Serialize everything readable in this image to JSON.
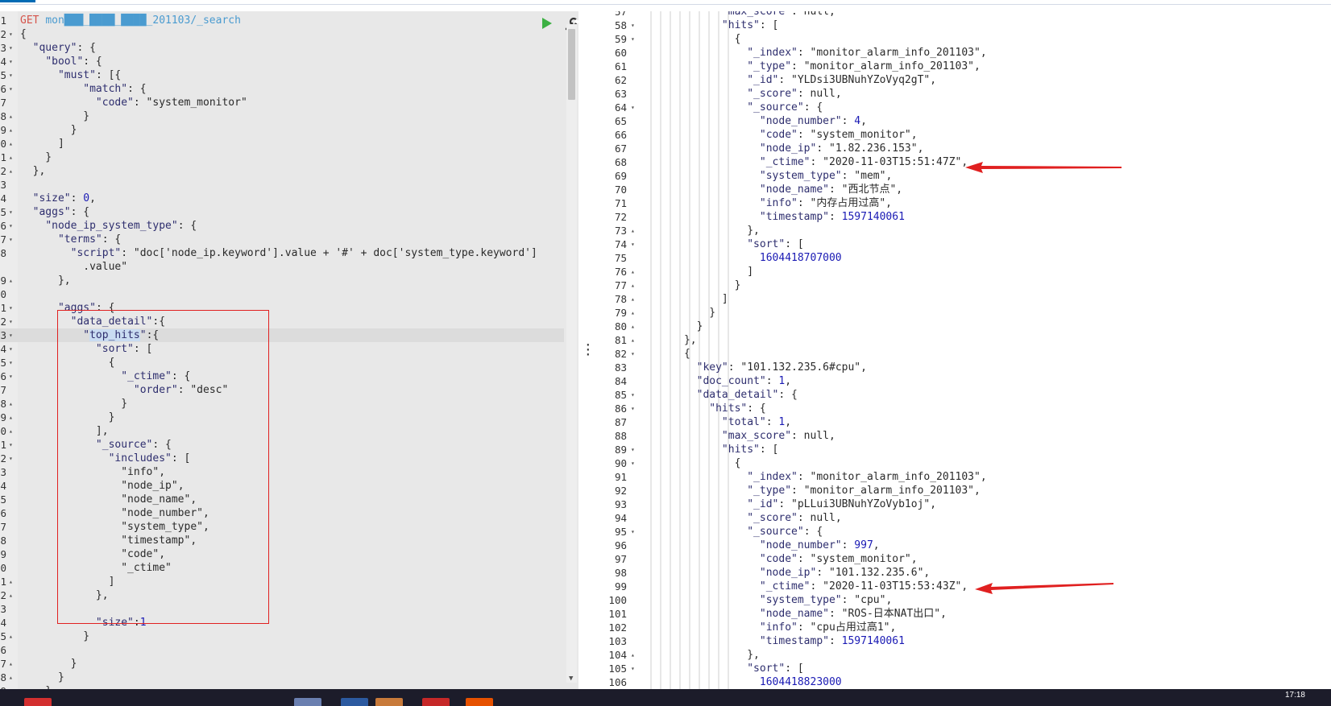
{
  "left_editor": {
    "lines": [
      {
        "num": "1",
        "fold": "",
        "html": "<span class=\"kw\">GET</span> <span class=\"url\">mon&#9608;&#9608;&#9608;_&#9608;&#9608;&#9608;&#9608;_&#9608;&#9608;&#9608;&#9608;_201103/_search</span>"
      },
      {
        "num": "2",
        "fold": "▾",
        "html": "{"
      },
      {
        "num": "3",
        "fold": "▾",
        "html": "  <span class=\"k\">\"query\"</span>: {"
      },
      {
        "num": "4",
        "fold": "▾",
        "html": "    <span class=\"k\">\"bool\"</span>: {"
      },
      {
        "num": "5",
        "fold": "▾",
        "html": "      <span class=\"k\">\"must\"</span>: [{"
      },
      {
        "num": "6",
        "fold": "▾",
        "html": "          <span class=\"k\">\"match\"</span>: {"
      },
      {
        "num": "7",
        "fold": "",
        "html": "            <span class=\"k\">\"code\"</span>: <span class=\"s\">\"system_monitor\"</span>"
      },
      {
        "num": "8",
        "fold": "▴",
        "html": "          }"
      },
      {
        "num": "9",
        "fold": "▴",
        "html": "        }"
      },
      {
        "num": "0",
        "fold": "▴",
        "html": "      ]"
      },
      {
        "num": "1",
        "fold": "▴",
        "html": "    }"
      },
      {
        "num": "2",
        "fold": "▴",
        "html": "  },"
      },
      {
        "num": "3",
        "fold": "",
        "html": ""
      },
      {
        "num": "4",
        "fold": "",
        "html": "  <span class=\"k\">\"size\"</span>: <span class=\"n\">0</span>,"
      },
      {
        "num": "5",
        "fold": "▾",
        "html": "  <span class=\"k\">\"aggs\"</span>: {"
      },
      {
        "num": "6",
        "fold": "▾",
        "html": "    <span class=\"k\">\"node_ip_system_type\"</span>: {"
      },
      {
        "num": "7",
        "fold": "▾",
        "html": "      <span class=\"k\">\"terms\"</span>: {"
      },
      {
        "num": "8",
        "fold": "",
        "html": "        <span class=\"k\">\"script\"</span>: <span class=\"s\">\"doc['node_ip.keyword'].value + '#' + doc['system_type.keyword']</span>"
      },
      {
        "num": "",
        "fold": "",
        "html": "          <span class=\"s\">.value\"</span>"
      },
      {
        "num": "9",
        "fold": "▴",
        "html": "      },"
      },
      {
        "num": "0",
        "fold": "",
        "html": ""
      },
      {
        "num": "1",
        "fold": "▾",
        "html": "      <span class=\"k\">\"aggs\"</span>: {"
      },
      {
        "num": "2",
        "fold": "▾",
        "html": "        <span class=\"k\">\"data_detail\"</span>:{"
      },
      {
        "num": "3",
        "fold": "▾",
        "html": "          <span class=\"k\">\"<span class=\"hl\">top_hits</span>\"</span>:{",
        "active": true
      },
      {
        "num": "4",
        "fold": "▾",
        "html": "            <span class=\"k\">\"sort\"</span>: ["
      },
      {
        "num": "5",
        "fold": "▾",
        "html": "              {"
      },
      {
        "num": "6",
        "fold": "▾",
        "html": "                <span class=\"k\">\"_ctime\"</span>: {"
      },
      {
        "num": "7",
        "fold": "",
        "html": "                  <span class=\"k\">\"order\"</span>: <span class=\"s\">\"desc\"</span>"
      },
      {
        "num": "8",
        "fold": "▴",
        "html": "                }"
      },
      {
        "num": "9",
        "fold": "▴",
        "html": "              }"
      },
      {
        "num": "0",
        "fold": "▴",
        "html": "            ],"
      },
      {
        "num": "1",
        "fold": "▾",
        "html": "            <span class=\"k\">\"_source\"</span>: {"
      },
      {
        "num": "2",
        "fold": "▾",
        "html": "              <span class=\"k\">\"includes\"</span>: ["
      },
      {
        "num": "3",
        "fold": "",
        "html": "                <span class=\"s\">\"info\"</span>,"
      },
      {
        "num": "4",
        "fold": "",
        "html": "                <span class=\"s\">\"node_ip\"</span>,"
      },
      {
        "num": "5",
        "fold": "",
        "html": "                <span class=\"s\">\"node_name\"</span>,"
      },
      {
        "num": "6",
        "fold": "",
        "html": "                <span class=\"s\">\"node_number\"</span>,"
      },
      {
        "num": "7",
        "fold": "",
        "html": "                <span class=\"s\">\"system_type\"</span>,"
      },
      {
        "num": "8",
        "fold": "",
        "html": "                <span class=\"s\">\"timestamp\"</span>,"
      },
      {
        "num": "9",
        "fold": "",
        "html": "                <span class=\"s\">\"code\"</span>,"
      },
      {
        "num": "0",
        "fold": "",
        "html": "                <span class=\"s\">\"_ctime\"</span>"
      },
      {
        "num": "1",
        "fold": "▴",
        "html": "              ]"
      },
      {
        "num": "2",
        "fold": "▴",
        "html": "            },"
      },
      {
        "num": "3",
        "fold": "",
        "html": ""
      },
      {
        "num": "4",
        "fold": "",
        "html": "            <span class=\"k\">\"size\"</span>:<span class=\"n\">1</span>"
      },
      {
        "num": "5",
        "fold": "▴",
        "html": "          }"
      },
      {
        "num": "6",
        "fold": "",
        "html": ""
      },
      {
        "num": "7",
        "fold": "▴",
        "html": "        }"
      },
      {
        "num": "8",
        "fold": "▴",
        "html": "      }"
      },
      {
        "num": "9",
        "fold": "▴",
        "html": "    }"
      }
    ]
  },
  "right_output": {
    "lines": [
      {
        "num": "57",
        "fold": "",
        "html": "            <span class=\"k\">\"max_score\"</span>: null,"
      },
      {
        "num": "58",
        "fold": "▾",
        "html": "            <span class=\"k\">\"hits\"</span>: ["
      },
      {
        "num": "59",
        "fold": "▾",
        "html": "              {"
      },
      {
        "num": "60",
        "fold": "",
        "html": "                <span class=\"k\">\"_index\"</span>: <span class=\"s\">\"monitor_alarm_info_201103\"</span>,"
      },
      {
        "num": "61",
        "fold": "",
        "html": "                <span class=\"k\">\"_type\"</span>: <span class=\"s\">\"monitor_alarm_info_201103\"</span>,"
      },
      {
        "num": "62",
        "fold": "",
        "html": "                <span class=\"k\">\"_id\"</span>: <span class=\"s\">\"YLDsi3UBNuhYZoVyq2gT\"</span>,"
      },
      {
        "num": "63",
        "fold": "",
        "html": "                <span class=\"k\">\"_score\"</span>: null,"
      },
      {
        "num": "64",
        "fold": "▾",
        "html": "                <span class=\"k\">\"_source\"</span>: {"
      },
      {
        "num": "65",
        "fold": "",
        "html": "                  <span class=\"k\">\"node_number\"</span>: <span class=\"n\">4</span>,"
      },
      {
        "num": "66",
        "fold": "",
        "html": "                  <span class=\"k\">\"code\"</span>: <span class=\"s\">\"system_monitor\"</span>,"
      },
      {
        "num": "67",
        "fold": "",
        "html": "                  <span class=\"k\">\"node_ip\"</span>: <span class=\"s\">\"1.82.236.153\"</span>,"
      },
      {
        "num": "68",
        "fold": "",
        "html": "                  <span class=\"k\">\"_ctime\"</span>: <span class=\"s\">\"2020-11-03T15:51:47Z\"</span>,"
      },
      {
        "num": "69",
        "fold": "",
        "html": "                  <span class=\"k\">\"system_type\"</span>: <span class=\"s\">\"mem\"</span>,"
      },
      {
        "num": "70",
        "fold": "",
        "html": "                  <span class=\"k\">\"node_name\"</span>: <span class=\"s\">\"西北节点\"</span>,"
      },
      {
        "num": "71",
        "fold": "",
        "html": "                  <span class=\"k\">\"info\"</span>: <span class=\"s\">\"内存占用过高\"</span>,"
      },
      {
        "num": "72",
        "fold": "",
        "html": "                  <span class=\"k\">\"timestamp\"</span>: <span class=\"n\">1597140061</span>"
      },
      {
        "num": "73",
        "fold": "▴",
        "html": "                },"
      },
      {
        "num": "74",
        "fold": "▾",
        "html": "                <span class=\"k\">\"sort\"</span>: ["
      },
      {
        "num": "75",
        "fold": "",
        "html": "                  <span class=\"n\">1604418707000</span>"
      },
      {
        "num": "76",
        "fold": "▴",
        "html": "                ]"
      },
      {
        "num": "77",
        "fold": "▴",
        "html": "              }"
      },
      {
        "num": "78",
        "fold": "▴",
        "html": "            ]"
      },
      {
        "num": "79",
        "fold": "▴",
        "html": "          }"
      },
      {
        "num": "80",
        "fold": "▴",
        "html": "        }"
      },
      {
        "num": "81",
        "fold": "▴",
        "html": "      },"
      },
      {
        "num": "82",
        "fold": "▾",
        "html": "      {"
      },
      {
        "num": "83",
        "fold": "",
        "html": "        <span class=\"k\">\"key\"</span>: <span class=\"s\">\"101.132.235.6#cpu\"</span>,"
      },
      {
        "num": "84",
        "fold": "",
        "html": "        <span class=\"k\">\"doc_count\"</span>: <span class=\"n\">1</span>,"
      },
      {
        "num": "85",
        "fold": "▾",
        "html": "        <span class=\"k\">\"data_detail\"</span>: {"
      },
      {
        "num": "86",
        "fold": "▾",
        "html": "          <span class=\"k\">\"hits\"</span>: {"
      },
      {
        "num": "87",
        "fold": "",
        "html": "            <span class=\"k\">\"total\"</span>: <span class=\"n\">1</span>,"
      },
      {
        "num": "88",
        "fold": "",
        "html": "            <span class=\"k\">\"max_score\"</span>: null,"
      },
      {
        "num": "89",
        "fold": "▾",
        "html": "            <span class=\"k\">\"hits\"</span>: ["
      },
      {
        "num": "90",
        "fold": "▾",
        "html": "              {"
      },
      {
        "num": "91",
        "fold": "",
        "html": "                <span class=\"k\">\"_index\"</span>: <span class=\"s\">\"monitor_alarm_info_201103\"</span>,"
      },
      {
        "num": "92",
        "fold": "",
        "html": "                <span class=\"k\">\"_type\"</span>: <span class=\"s\">\"monitor_alarm_info_201103\"</span>,"
      },
      {
        "num": "93",
        "fold": "",
        "html": "                <span class=\"k\">\"_id\"</span>: <span class=\"s\">\"pLLui3UBNuhYZoVyb1oj\"</span>,"
      },
      {
        "num": "94",
        "fold": "",
        "html": "                <span class=\"k\">\"_score\"</span>: null,"
      },
      {
        "num": "95",
        "fold": "▾",
        "html": "                <span class=\"k\">\"_source\"</span>: {"
      },
      {
        "num": "96",
        "fold": "",
        "html": "                  <span class=\"k\">\"node_number\"</span>: <span class=\"n\">997</span>,"
      },
      {
        "num": "97",
        "fold": "",
        "html": "                  <span class=\"k\">\"code\"</span>: <span class=\"s\">\"system_monitor\"</span>,"
      },
      {
        "num": "98",
        "fold": "",
        "html": "                  <span class=\"k\">\"node_ip\"</span>: <span class=\"s\">\"101.132.235.6\"</span>,"
      },
      {
        "num": "99",
        "fold": "",
        "html": "                  <span class=\"k\">\"_ctime\"</span>: <span class=\"s\">\"2020-11-03T15:53:43Z\"</span>,"
      },
      {
        "num": "100",
        "fold": "",
        "html": "                  <span class=\"k\">\"system_type\"</span>: <span class=\"s\">\"cpu\"</span>,"
      },
      {
        "num": "101",
        "fold": "",
        "html": "                  <span class=\"k\">\"node_name\"</span>: <span class=\"s\">\"ROS-日本NAT出口\"</span>,"
      },
      {
        "num": "102",
        "fold": "",
        "html": "                  <span class=\"k\">\"info\"</span>: <span class=\"s\">\"cpu占用过高1\"</span>,"
      },
      {
        "num": "103",
        "fold": "",
        "html": "                  <span class=\"k\">\"timestamp\"</span>: <span class=\"n\">1597140061</span>"
      },
      {
        "num": "104",
        "fold": "▴",
        "html": "                },"
      },
      {
        "num": "105",
        "fold": "▾",
        "html": "                <span class=\"k\">\"sort\"</span>: ["
      },
      {
        "num": "106",
        "fold": "",
        "html": "                  <span class=\"n\">1604418823000</span>"
      }
    ]
  },
  "taskbar": {
    "clock": "17:18"
  },
  "colors": {
    "editor_bg": "#e8e8e8",
    "keyword_get": "#d5534a",
    "url": "#4a9bd0",
    "number": "#1a1ab4",
    "annotation_red": "#e02020",
    "run_green": "#3cb043"
  }
}
